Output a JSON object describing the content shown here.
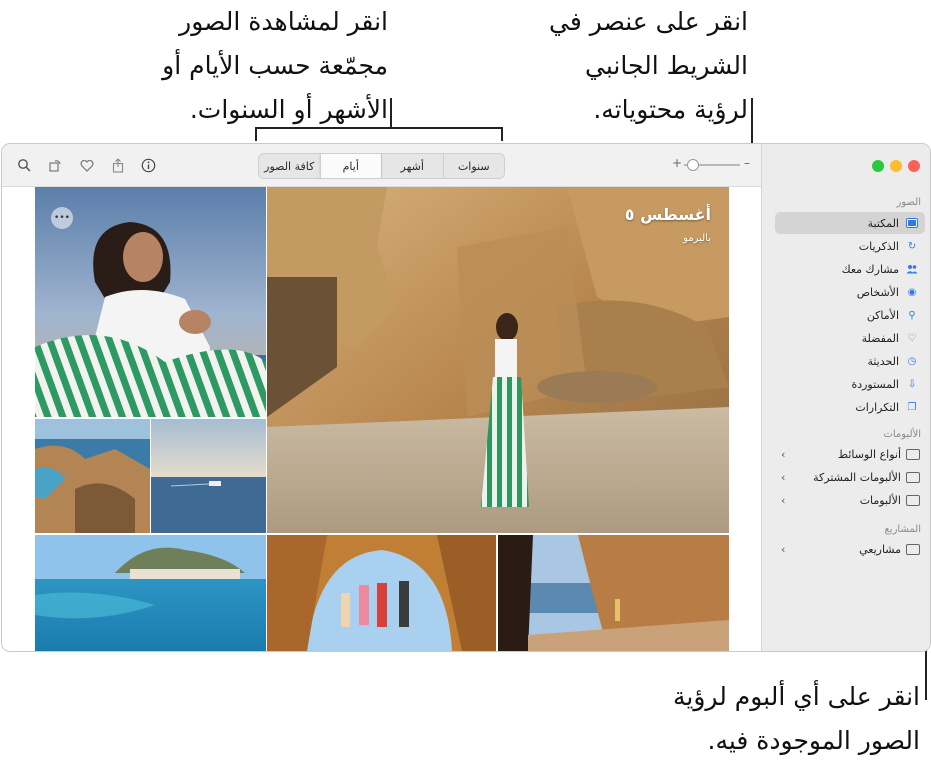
{
  "callouts": {
    "top_center": [
      "انقر لمشاهدة الصور",
      "مجمّعة حسب الأيام أو",
      "الأشهر أو السنوات."
    ],
    "top_right": [
      "انقر على عنصر في",
      "الشريط الجانبي",
      "لرؤية محتوياته."
    ],
    "bottom_right": [
      "انقر على أي ألبوم لرؤية",
      "الصور الموجودة فيه."
    ]
  },
  "toolbar": {
    "segments": [
      "سنوات",
      "أشهر",
      "أيام",
      "كافة الصور"
    ],
    "selected_segment": "أيام",
    "zoom_minus": "–",
    "zoom_plus": "+",
    "zoom_level": 0.05,
    "icons": [
      "info-icon",
      "share-icon",
      "heart-icon",
      "rotate-icon",
      "search-icon"
    ]
  },
  "main": {
    "date_title": "أغسطس ٥",
    "location": "باليرمو",
    "more_glyph": "•••"
  },
  "sidebar": {
    "traffic_lights": {
      "close": "#ff5f57",
      "minimize": "#febc2e",
      "zoom": "#28c840"
    },
    "sections": [
      {
        "header": "الصور",
        "items": [
          {
            "label": "المكتبة",
            "icon": "library-icon",
            "glyph": "▣"
          },
          {
            "label": "الذكريات",
            "icon": "memories-icon",
            "glyph": "↻"
          },
          {
            "label": "مشارك معك",
            "icon": "shared-with-you-icon",
            "glyph": "👥"
          },
          {
            "label": "الأشخاص",
            "icon": "people-icon",
            "glyph": "◉"
          },
          {
            "label": "الأماكن",
            "icon": "places-icon",
            "glyph": "⚲"
          },
          {
            "label": "المفضلة",
            "icon": "favorites-icon",
            "glyph": "♡"
          },
          {
            "label": "الحديثة",
            "icon": "recents-icon",
            "glyph": "◷"
          },
          {
            "label": "المستوردة",
            "icon": "imports-icon",
            "glyph": "⇩"
          },
          {
            "label": "التكرارات",
            "icon": "duplicates-icon",
            "glyph": "❐"
          }
        ]
      },
      {
        "header": "الألبومات",
        "items": [
          {
            "label": "أنواع الوسائط",
            "icon": "folder-icon"
          },
          {
            "label": "الألبومات المشتركة",
            "icon": "shared-albums-icon"
          },
          {
            "label": "الألبومات",
            "icon": "folder-icon"
          }
        ]
      },
      {
        "header": "المشاريع",
        "items": [
          {
            "label": "مشاريعي",
            "icon": "folder-icon"
          }
        ]
      }
    ],
    "selected_item": "المكتبة",
    "accent": "#2f7be5"
  }
}
